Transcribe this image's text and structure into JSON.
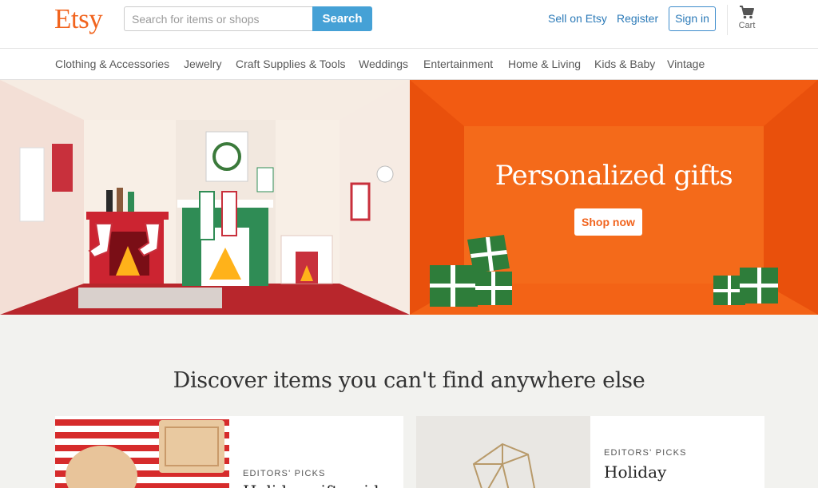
{
  "header": {
    "logo": "Etsy",
    "search": {
      "placeholder": "Search for items or shops",
      "value": "",
      "button_label": "Search"
    },
    "sell_label": "Sell on Etsy",
    "register_label": "Register",
    "signin_label": "Sign in",
    "cart_label": "Cart"
  },
  "categories": [
    "Clothing & Accessories",
    "Jewelry",
    "Craft Supplies & Tools",
    "Weddings",
    "Entertainment",
    "Home & Living",
    "Kids & Baby",
    "Vintage"
  ],
  "hero": {
    "title": "Personalized gifts",
    "cta_label": "Shop now",
    "colors": {
      "accent": "#f25b12",
      "left_bg": "#f4e6dc"
    }
  },
  "discover": {
    "title": "Discover items you can't find anywhere else",
    "cards": [
      {
        "eyebrow": "EDITORS' PICKS",
        "title": "Holiday gift guide"
      },
      {
        "eyebrow": "EDITORS' PICKS",
        "title": "Holiday"
      }
    ]
  },
  "colors": {
    "brand": "#f1641e",
    "link": "#2b7ab8",
    "search_button": "#45a1d6"
  },
  "icons": {
    "cart": "cart-icon"
  }
}
